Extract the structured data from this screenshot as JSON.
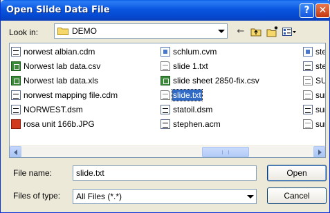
{
  "window": {
    "title": "Open Slide Data File",
    "help_glyph": "?",
    "close_glyph": "✕"
  },
  "lookin": {
    "label": "Look in:",
    "value": "DEMO"
  },
  "toolbar": {
    "back_glyph": "←",
    "up_glyph": "⇧",
    "newfolder_glyph": "✱",
    "views_glyph": "▦▾"
  },
  "files": {
    "column1": [
      {
        "name": "norwest albian.cdm",
        "icon": "dsm-file-icon"
      },
      {
        "name": "Norwest lab data.csv",
        "icon": "excel-file-icon"
      },
      {
        "name": "Norwest lab data.xls",
        "icon": "excel-file-icon"
      },
      {
        "name": "norwest mapping file.cdm",
        "icon": "dsm-file-icon"
      },
      {
        "name": "NORWEST.dsm",
        "icon": "dsm-file-icon"
      },
      {
        "name": "rosa unit 166b.JPG",
        "icon": "image-file-icon"
      }
    ],
    "column2": [
      {
        "name": "schlum.cvm",
        "icon": "cvm-file-icon"
      },
      {
        "name": "slide 1.txt",
        "icon": "text-file-icon"
      },
      {
        "name": "slide sheet 2850-fix.csv",
        "icon": "excel-file-icon"
      },
      {
        "name": "slide.txt",
        "icon": "text-file-icon",
        "selected": true
      },
      {
        "name": "statoil.dsm",
        "icon": "dsm-file-icon"
      },
      {
        "name": "stephen.acm",
        "icon": "dsm-file-icon"
      }
    ],
    "column3": [
      {
        "name": "step",
        "icon": "cvm-file-icon"
      },
      {
        "name": "step",
        "icon": "dsm-file-icon"
      },
      {
        "name": "SUR",
        "icon": "text-file-icon"
      },
      {
        "name": "surv",
        "icon": "text-file-icon"
      },
      {
        "name": "surv",
        "icon": "dsm-file-icon"
      },
      {
        "name": "surv",
        "icon": "text-file-icon"
      }
    ]
  },
  "filename": {
    "label": "File name:",
    "value": "slide.txt"
  },
  "filetype": {
    "label": "Files of type:",
    "value": "All Files (*.*)"
  },
  "buttons": {
    "open": "Open",
    "cancel": "Cancel"
  },
  "colors": {
    "titlebar": "#0a56e0",
    "selection": "#316ac5",
    "dialog_bg": "#ece9d8"
  }
}
